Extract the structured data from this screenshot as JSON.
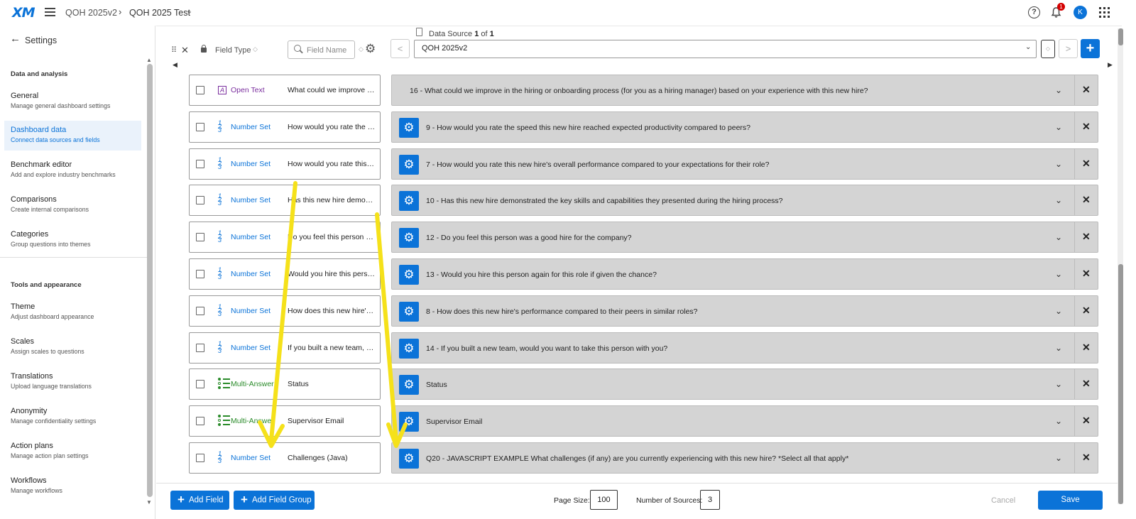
{
  "header": {
    "logo": "XM",
    "breadcrumb": [
      "QOH 2025v2",
      "QOH 2025 Test"
    ],
    "breadcrumb_separator": "›",
    "caret": "⌄",
    "help": "?",
    "notification_count": "1",
    "avatar_initial": "K"
  },
  "sidebar": {
    "back_label": "Settings",
    "back_arrow": "←",
    "sections": [
      {
        "title": "Data and analysis"
      },
      {
        "title": "Tools and appearance"
      }
    ],
    "items": [
      {
        "title": "General",
        "subtitle": "Manage general dashboard settings"
      },
      {
        "title": "Dashboard data",
        "subtitle": "Connect data sources and fields",
        "active": true
      },
      {
        "title": "Benchmark editor",
        "subtitle": "Add and explore industry benchmarks"
      },
      {
        "title": "Comparisons",
        "subtitle": "Create internal comparisons"
      },
      {
        "title": "Categories",
        "subtitle": "Group questions into themes"
      },
      {
        "title": "Theme",
        "subtitle": "Adjust dashboard appearance"
      },
      {
        "title": "Scales",
        "subtitle": "Assign scales to questions"
      },
      {
        "title": "Translations",
        "subtitle": "Upload language translations"
      },
      {
        "title": "Anonymity",
        "subtitle": "Manage confidentiality settings"
      },
      {
        "title": "Action plans",
        "subtitle": "Manage action plan settings"
      },
      {
        "title": "Workflows",
        "subtitle": "Manage workflows"
      }
    ]
  },
  "toolbar": {
    "field_type_label": "Field Type",
    "field_name_placeholder": "Field Name",
    "data_source_prefix": "Data Source",
    "data_source_index": "1",
    "data_source_of": "of",
    "data_source_total": "1",
    "data_source_value": "QOH 2025v2",
    "add": "+",
    "prev": "<",
    "next": ">"
  },
  "fields": [
    {
      "type": "Open Text",
      "kind": "open",
      "name": "What could we improve in the hiring or onboarding process",
      "mapping": "16 - What could we improve in the hiring or onboarding process (for you as a hiring manager) based on your experience with this new hire?",
      "gear": false
    },
    {
      "type": "Number Set",
      "kind": "num",
      "name": "How would you rate the speed",
      "mapping": "9 - How would you rate the speed this new hire reached expected productivity compared to peers?",
      "gear": true
    },
    {
      "type": "Number Set",
      "kind": "num",
      "name": "How would you rate this new hire",
      "mapping": "7 - How would you rate this new hire's overall performance compared to your expectations for their role?",
      "gear": true
    },
    {
      "type": "Number Set",
      "kind": "num",
      "name": "Has this new hire demonstrated",
      "mapping": "10 - Has this new hire demonstrated the key skills and capabilities they presented during the hiring process?",
      "gear": true
    },
    {
      "type": "Number Set",
      "kind": "num",
      "name": "Do you feel this person was",
      "mapping": "12 - Do you feel this person was a good hire for the company?",
      "gear": true
    },
    {
      "type": "Number Set",
      "kind": "num",
      "name": "Would you hire this person again",
      "mapping": "13 - Would you hire this person again for this role if given the chance?",
      "gear": true
    },
    {
      "type": "Number Set",
      "kind": "num",
      "name": "How does this new hire's performance",
      "mapping": "8 - How does this new hire's performance compared to their peers in similar roles?",
      "gear": true
    },
    {
      "type": "Number Set",
      "kind": "num",
      "name": "If you built a new team, would",
      "mapping": "14 - If you built a new team, would you want to take this person with you?",
      "gear": true
    },
    {
      "type": "Multi-Answer",
      "kind": "multi",
      "name": "Status",
      "mapping": "Status",
      "gear": true
    },
    {
      "type": "Multi-Answer",
      "kind": "multi",
      "name": "Supervisor Email",
      "mapping": "Supervisor Email",
      "gear": true
    },
    {
      "type": "Number Set",
      "kind": "num",
      "name": "Challenges (Java)",
      "mapping": "Q20 - JAVASCRIPT EXAMPLE What challenges (if any) are you currently experiencing with this new hire? *Select all that apply*",
      "gear": true
    }
  ],
  "footer": {
    "add_field": "Add Field",
    "add_field_group": "Add Field Group",
    "page_size_label": "Page Size:",
    "page_size": "100",
    "num_sources_label": "Number of Sources:",
    "num_sources": "3",
    "cancel": "Cancel",
    "save": "Save"
  },
  "colors": {
    "accent": "#0b73d8",
    "open_text": "#7a2e9e",
    "multi_answer": "#2a8b2a",
    "annotation_arrow": "#f5e11a"
  }
}
